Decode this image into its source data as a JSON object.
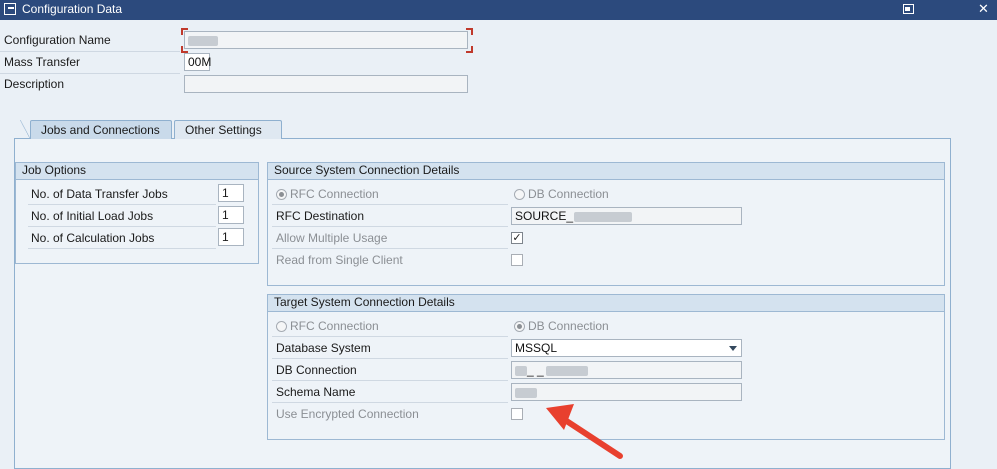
{
  "window": {
    "title": "Configuration Data",
    "icon": "edit-window-icon",
    "close_label": "✕"
  },
  "header": {
    "configuration_name": {
      "label": "Configuration Name",
      "value": ""
    },
    "mass_transfer": {
      "label": "Mass Transfer",
      "value": "00M"
    },
    "description": {
      "label": "Description",
      "value": ""
    }
  },
  "tabs": [
    {
      "label": "Jobs and Connections",
      "active": true
    },
    {
      "label": "Other Settings",
      "active": false
    }
  ],
  "job_options": {
    "title": "Job Options",
    "rows": [
      {
        "label": "No. of Data Transfer Jobs",
        "value": "1"
      },
      {
        "label": "No. of Initial Load Jobs",
        "value": "1"
      },
      {
        "label": "No. of Calculation Jobs",
        "value": "1"
      }
    ]
  },
  "source": {
    "title": "Source System Connection Details",
    "rfc_connection": "RFC Connection",
    "db_connection": "DB Connection",
    "selected": "RFC Connection",
    "rfc_destination_label": "RFC Destination",
    "rfc_destination_value": "SOURCE_",
    "allow_multiple_label": "Allow Multiple Usage",
    "allow_multiple_checked": true,
    "read_single_label": "Read from Single Client",
    "read_single_checked": false
  },
  "target": {
    "title": "Target System Connection Details",
    "rfc_connection": "RFC Connection",
    "db_connection": "DB Connection",
    "selected": "DB Connection",
    "database_system_label": "Database System",
    "database_system_value": "MSSQL",
    "db_connection_label": "DB Connection",
    "db_connection_value": "_ _",
    "schema_name_label": "Schema Name",
    "schema_name_value": "",
    "use_encrypted_label": "Use Encrypted Connection",
    "use_encrypted_checked": false
  },
  "colors": {
    "titlebar": "#2c4a7d",
    "annotation_arrow": "#e8402e",
    "background": "#eaf0f6"
  }
}
